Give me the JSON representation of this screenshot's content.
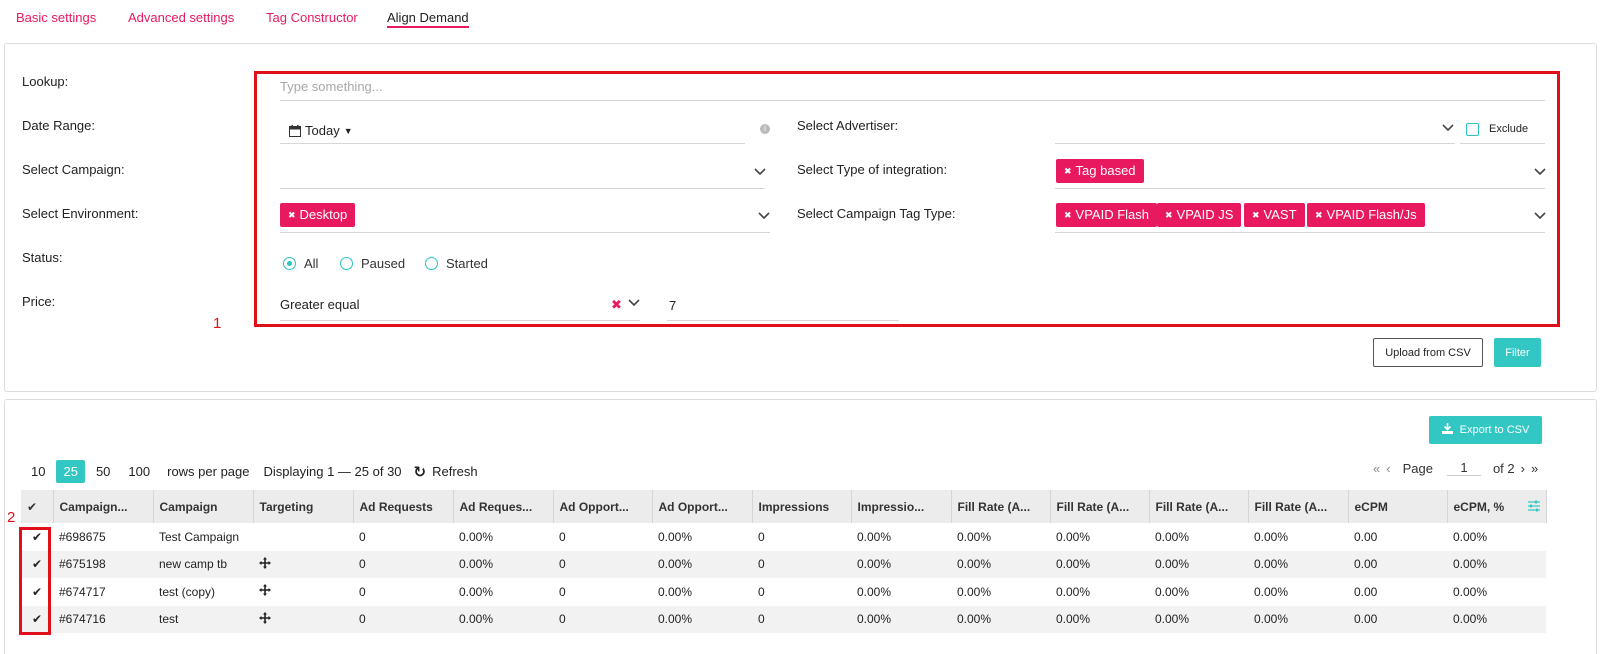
{
  "tabs": [
    "Basic settings",
    "Advanced settings",
    "Tag Constructor",
    "Align Demand"
  ],
  "filters": {
    "lookup_label": "Lookup:",
    "lookup_placeholder": "Type something...",
    "date_label": "Date Range:",
    "date_value": "Today",
    "campaign_label": "Select Campaign:",
    "environment_label": "Select Environment:",
    "environment_tags": [
      "Desktop"
    ],
    "status_label": "Status:",
    "status_options": [
      "All",
      "Paused",
      "Started"
    ],
    "status_selected": "All",
    "price_label": "Price:",
    "price_operator": "Greater equal",
    "price_value": "7",
    "advertiser_label": "Select Advertiser:",
    "exclude_label": "Exclude",
    "integration_label": "Select Type of integration:",
    "integration_tags": [
      "Tag based"
    ],
    "tagtype_label": "Select Campaign Tag Type:",
    "tagtype_tags": [
      "VPAID Flash",
      "VPAID JS",
      "VAST",
      "VPAID Flash/Js"
    ],
    "upload_button": "Upload from CSV",
    "filter_button": "Filter"
  },
  "annotations": [
    "1",
    "2"
  ],
  "results": {
    "export_button": "Export to CSV",
    "rows_options": [
      "10",
      "25",
      "50",
      "100"
    ],
    "rows_selected": "25",
    "rows_per_page_label": "rows per page",
    "displaying": "Displaying 1 — 25 of 30",
    "refresh": "Refresh",
    "pagination": {
      "page_label": "Page",
      "page": "1",
      "of": "of 2"
    },
    "columns": [
      "Campaign...",
      "Campaign",
      "Targeting",
      "Ad Requests",
      "Ad Reques...",
      "Ad Opport...",
      "Ad Opport...",
      "Impressions",
      "Impressio...",
      "Fill Rate (A...",
      "Fill Rate (A...",
      "Fill Rate (A...",
      "Fill Rate (A...",
      "eCPM",
      "eCPM, %"
    ],
    "rows": [
      {
        "id": "#698675",
        "name": "Test Campaign",
        "targeting": false,
        "cells": [
          "0",
          "0.00%",
          "0",
          "0.00%",
          "0",
          "0.00%",
          "0.00%",
          "0.00%",
          "0.00%",
          "0.00%",
          "0.00",
          "0.00%"
        ]
      },
      {
        "id": "#675198",
        "name": "new camp tb",
        "targeting": true,
        "cells": [
          "0",
          "0.00%",
          "0",
          "0.00%",
          "0",
          "0.00%",
          "0.00%",
          "0.00%",
          "0.00%",
          "0.00%",
          "0.00",
          "0.00%"
        ]
      },
      {
        "id": "#674717",
        "name": "test (copy)",
        "targeting": true,
        "cells": [
          "0",
          "0.00%",
          "0",
          "0.00%",
          "0",
          "0.00%",
          "0.00%",
          "0.00%",
          "0.00%",
          "0.00%",
          "0.00",
          "0.00%"
        ]
      },
      {
        "id": "#674716",
        "name": "test",
        "targeting": true,
        "cells": [
          "0",
          "0.00%",
          "0",
          "0.00%",
          "0",
          "0.00%",
          "0.00%",
          "0.00%",
          "0.00%",
          "0.00%",
          "0.00",
          "0.00%"
        ]
      }
    ]
  },
  "colors": {
    "accent": "#e8195f",
    "teal": "#33c7c3",
    "annotation": "#e0101a"
  }
}
